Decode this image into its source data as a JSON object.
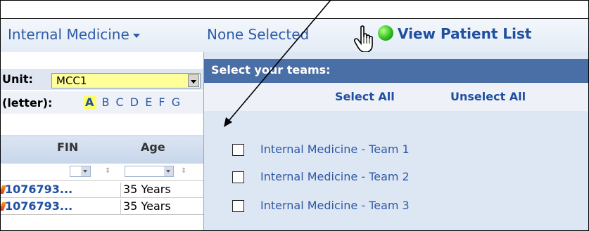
{
  "header": {
    "department_label": "Internal Medicine",
    "team_selector_label": "None Selected",
    "view_list_label": "View Patient List",
    "status_color": "#2fbf1f"
  },
  "filters": {
    "unit_label": "Unit:",
    "unit_value": "MCC1",
    "letter_label": "(letter):",
    "letters_selected": "A",
    "letters_rest": "B C D E F G"
  },
  "table": {
    "columns": [
      "FIN",
      "Age"
    ],
    "rows": [
      {
        "fin": "1076793...",
        "age": "35 Years"
      },
      {
        "fin": "1076793...",
        "age": "35 Years"
      }
    ]
  },
  "team_dropdown": {
    "title": "Select your teams:",
    "select_all_label": "Select All",
    "unselect_all_label": "Unselect All",
    "teams": [
      {
        "label": "Internal Medicine - Team 1",
        "checked": false
      },
      {
        "label": "Internal Medicine - Team 2",
        "checked": false
      },
      {
        "label": "Internal Medicine - Team 3",
        "checked": false
      }
    ]
  },
  "icons": [
    "hand-cursor-icon",
    "status-dot-icon",
    "caret-down-icon",
    "dropdown-arrow-icon",
    "sort-icon",
    "annotation-arrow"
  ]
}
